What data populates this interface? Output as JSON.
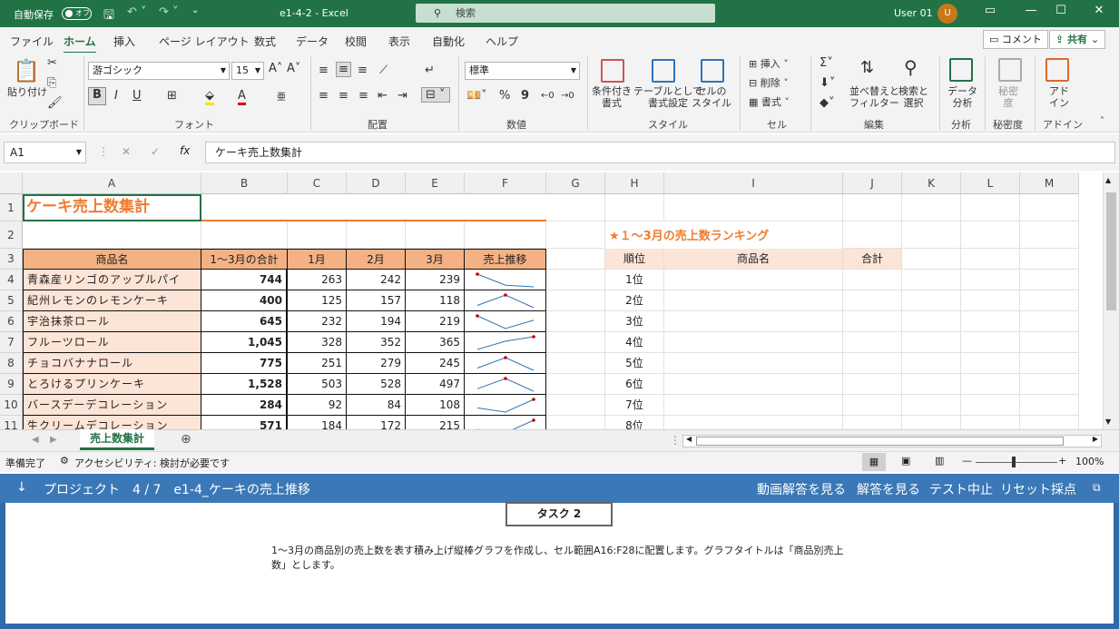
{
  "titlebar": {
    "autosave_label": "自動保存",
    "autosave_state": "オフ",
    "filename": "e1-4-2 - Excel",
    "search_placeholder": "検索",
    "user": "User 01",
    "avatar": "U"
  },
  "menu": {
    "items": [
      "ファイル",
      "ホーム",
      "挿入",
      "ページ レイアウト",
      "数式",
      "データ",
      "校閲",
      "表示",
      "自動化",
      "ヘルプ"
    ],
    "active": "ホーム",
    "comment": "コメント",
    "share": "共有"
  },
  "ribbon": {
    "clipboard": {
      "paste": "貼り付け",
      "label": "クリップボード"
    },
    "font": {
      "name": "游ゴシック",
      "size": "15",
      "label": "フォント",
      "bold": "B",
      "italic": "I",
      "underline": "U"
    },
    "alignment": {
      "label": "配置"
    },
    "number": {
      "format": "標準",
      "label": "数値",
      "percent": "%",
      "comma": "9"
    },
    "styles": {
      "cond": "条件付き\n書式",
      "table": "テーブルとして\n書式設定",
      "cellstyle": "セルの\nスタイル",
      "label": "スタイル"
    },
    "cells": {
      "insert": "挿入",
      "delete": "削除",
      "format": "書式",
      "label": "セル"
    },
    "edit": {
      "sort": "並べ替えと\nフィルター",
      "find": "検索と\n選択",
      "label": "編集"
    },
    "analysis": {
      "btn": "データ\n分析",
      "label": "分析"
    },
    "sensitivity": {
      "btn": "秘密\n度",
      "label": "秘密度"
    },
    "addin": {
      "btn": "アド\nイン",
      "label": "アドイン"
    }
  },
  "formula": {
    "namebox": "A1",
    "content": "ケーキ売上数集計"
  },
  "sheet": {
    "columns": [
      "A",
      "B",
      "C",
      "D",
      "E",
      "F",
      "G",
      "H",
      "I",
      "J",
      "K",
      "L",
      "M"
    ],
    "rows": [
      "1",
      "2",
      "3",
      "4",
      "5",
      "6",
      "7",
      "8",
      "9",
      "10",
      "11"
    ],
    "title": "ケーキ売上数集計",
    "headers": [
      "商品名",
      "1～3月の合計",
      "1月",
      "2月",
      "3月",
      "売上推移"
    ],
    "data": [
      {
        "name": "青森産リンゴのアップルパイ",
        "total": "744",
        "m1": "263",
        "m2": "242",
        "m3": "239",
        "spark": [
          263,
          242,
          239
        ]
      },
      {
        "name": "紀州レモンのレモンケーキ",
        "total": "400",
        "m1": "125",
        "m2": "157",
        "m3": "118",
        "spark": [
          125,
          157,
          118
        ]
      },
      {
        "name": "宇治抹茶ロール",
        "total": "645",
        "m1": "232",
        "m2": "194",
        "m3": "219",
        "spark": [
          232,
          194,
          219
        ]
      },
      {
        "name": "フルーツロール",
        "total": "1,045",
        "m1": "328",
        "m2": "352",
        "m3": "365",
        "spark": [
          328,
          352,
          365
        ]
      },
      {
        "name": "チョコバナナロール",
        "total": "775",
        "m1": "251",
        "m2": "279",
        "m3": "245",
        "spark": [
          251,
          279,
          245
        ]
      },
      {
        "name": "とろけるプリンケーキ",
        "total": "1,528",
        "m1": "503",
        "m2": "528",
        "m3": "497",
        "spark": [
          503,
          528,
          497
        ]
      },
      {
        "name": "バースデーデコレーション",
        "total": "284",
        "m1": "92",
        "m2": "84",
        "m3": "108",
        "spark": [
          92,
          84,
          108
        ]
      },
      {
        "name": "生クリームデコレーション",
        "total": "571",
        "m1": "184",
        "m2": "172",
        "m3": "215",
        "spark": [
          184,
          172,
          215
        ]
      }
    ],
    "ranking_title": "★１～3月の売上数ランキング",
    "ranking_headers": [
      "順位",
      "商品名",
      "合計"
    ],
    "ranks": [
      "1位",
      "2位",
      "3位",
      "4位",
      "5位",
      "6位",
      "7位",
      "8位"
    ],
    "colors": {
      "accent": "#ed7d31",
      "header_fill": "#f4b184",
      "name_fill": "#fce4d6",
      "excel_green": "#217346"
    }
  },
  "sheettab": "売上数集計",
  "status": {
    "ready": "準備完了",
    "accessibility": "アクセシビリティ: 検討が必要です",
    "zoom": "100%"
  },
  "task": {
    "project": "プロジェクト　4 / 7　e1-4_ケーキの売上推移",
    "video": "動画解答を見る",
    "answer": "解答を見る",
    "stop": "テスト中止",
    "reset": "リセット",
    "grade": "採点",
    "tab": "タスク 2",
    "instruction_line1": "1～3月の商品別の売上数を表す積み上げ縦棒グラフを作成し、セル範囲A16:F28に配置します。グラフタイトルは「商品別売上",
    "instruction_line2": "数」とします。"
  }
}
